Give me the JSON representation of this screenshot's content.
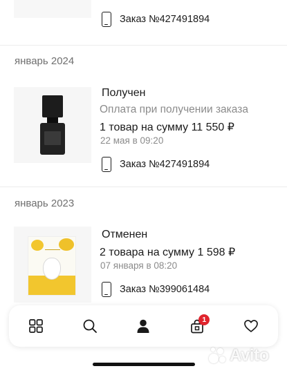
{
  "orders_top": {
    "order_number": "Заказ №427491894"
  },
  "groups": [
    {
      "month": "январь 2024",
      "order": {
        "status": "Получен",
        "payment": "Оплата при получении заказа",
        "summary": "1 товар на сумму 11 550 ₽",
        "date": "22 мая в 09:20",
        "order_number": "Заказ №427491894",
        "image_icon": "perfume-bottle"
      }
    },
    {
      "month": "январь 2023",
      "order": {
        "status": "Отменен",
        "summary": "2 товара на сумму 1 598 ₽",
        "date": "07 января в 08:20",
        "order_number": "Заказ №399061484",
        "image_icon": "face-mask-pack"
      }
    }
  ],
  "bottom_nav": {
    "items": [
      {
        "icon": "catalog-grid-icon"
      },
      {
        "icon": "search-icon"
      },
      {
        "icon": "profile-icon",
        "active": true
      },
      {
        "icon": "cart-icon",
        "badge": "1"
      },
      {
        "icon": "favorites-heart-icon"
      }
    ],
    "badge_color": "#e0242d"
  },
  "watermark": {
    "text": "Avito"
  }
}
